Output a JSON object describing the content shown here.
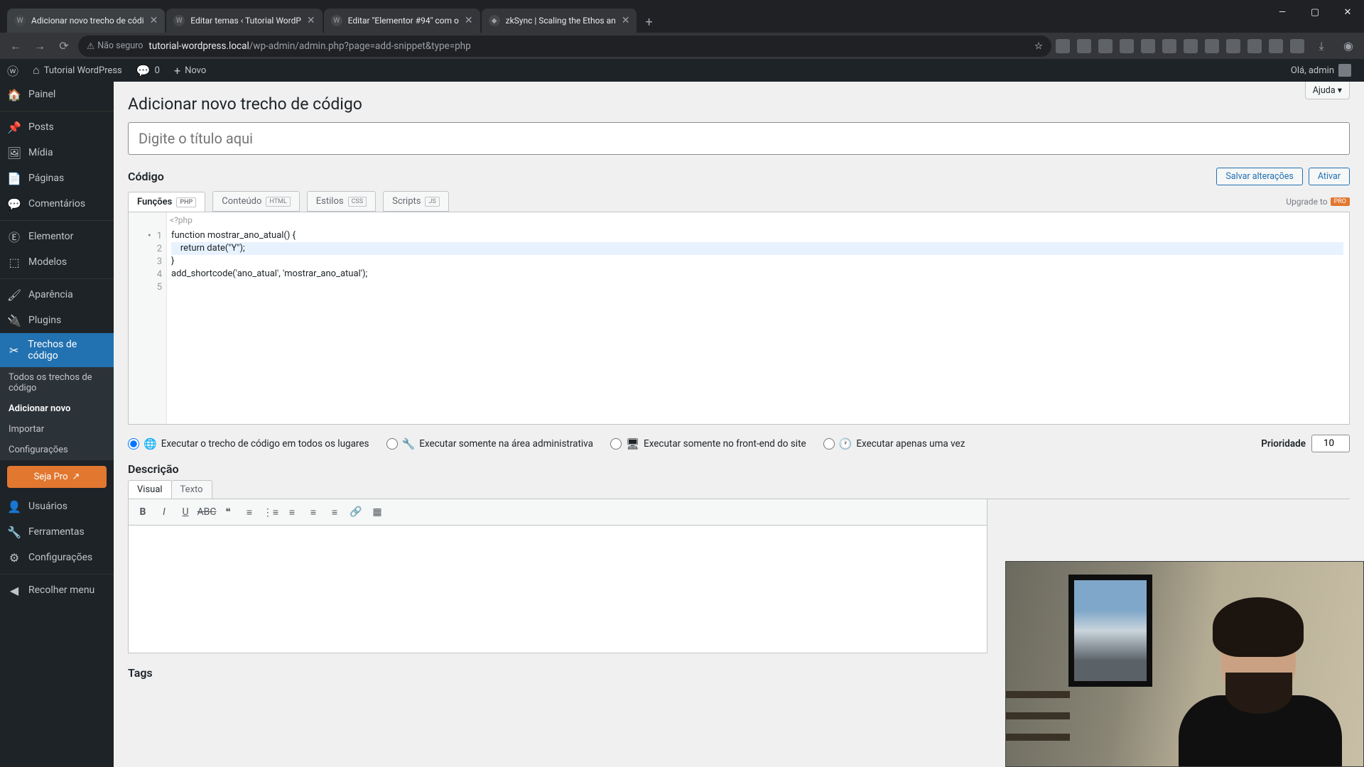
{
  "browser": {
    "tabs": [
      {
        "title": "Adicionar novo trecho de códi"
      },
      {
        "title": "Editar temas ‹ Tutorial WordP"
      },
      {
        "title": "Editar \"Elementor #94\" com o"
      },
      {
        "title": "zkSync | Scaling the Ethos an"
      }
    ],
    "not_secure": "Não seguro",
    "url_host": "tutorial-wordpress.local",
    "url_path": "/wp-admin/admin.php?page=add-snippet&type=php"
  },
  "adminbar": {
    "site": "Tutorial WordPress",
    "comments": "0",
    "new": "Novo",
    "greeting": "Olá, admin"
  },
  "sidebar": {
    "items": [
      {
        "icon": "🏠",
        "label": "Painel"
      },
      {
        "icon": "📌",
        "label": "Posts"
      },
      {
        "icon": "🖼",
        "label": "Mídia"
      },
      {
        "icon": "📄",
        "label": "Páginas"
      },
      {
        "icon": "💬",
        "label": "Comentários"
      },
      {
        "icon": "Ⓔ",
        "label": "Elementor"
      },
      {
        "icon": "⬚",
        "label": "Modelos"
      },
      {
        "icon": "🖌",
        "label": "Aparência"
      },
      {
        "icon": "🔌",
        "label": "Plugins"
      },
      {
        "icon": "✂",
        "label": "Trechos de código"
      },
      {
        "icon": "👤",
        "label": "Usuários"
      },
      {
        "icon": "🔧",
        "label": "Ferramentas"
      },
      {
        "icon": "⚙",
        "label": "Configurações"
      },
      {
        "icon": "◀",
        "label": "Recolher menu"
      }
    ],
    "submenu": [
      "Todos os trechos de código",
      "Adicionar novo",
      "Importar",
      "Configurações"
    ],
    "seja_pro": "Seja Pro"
  },
  "page": {
    "help": "Ajuda ▾",
    "title": "Adicionar novo trecho de código",
    "title_placeholder": "Digite o título aqui",
    "codigo": "Código",
    "save": "Salvar alterações",
    "activate": "Ativar",
    "code_tabs": [
      {
        "label": "Funções",
        "badge": "PHP"
      },
      {
        "label": "Conteúdo",
        "badge": "HTML"
      },
      {
        "label": "Estilos",
        "badge": "CSS"
      },
      {
        "label": "Scripts",
        "badge": "JS"
      }
    ],
    "upgrade": "Upgrade to",
    "pro": "PRO",
    "php_open": "<?php",
    "code_lines": {
      "l1": "function mostrar_ano_atual() {",
      "l2": "    return date(\"Y\");",
      "l3": "}",
      "l4": "add_shortcode('ano_atual', 'mostrar_ano_atual');",
      "l5": ""
    },
    "run": [
      "Executar o trecho de código em todos os lugares",
      "Executar somente na área administrativa",
      "Executar somente no front-end do site",
      "Executar apenas uma vez"
    ],
    "priority_label": "Prioridade",
    "priority_value": "10",
    "descricao": "Descrição",
    "desc_tabs": [
      "Visual",
      "Texto"
    ],
    "tags": "Tags"
  }
}
